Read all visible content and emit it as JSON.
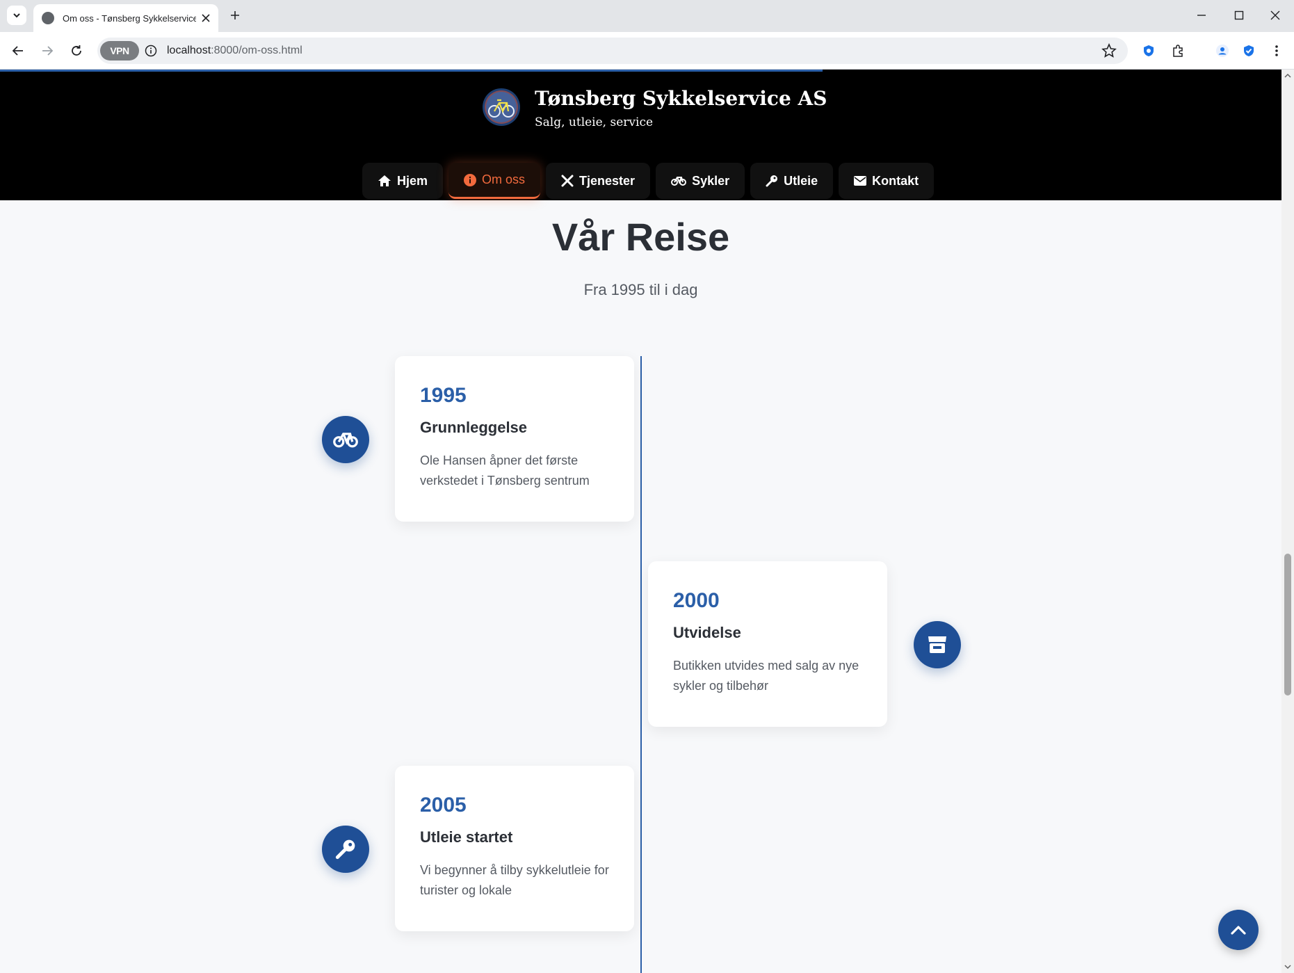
{
  "browser": {
    "tab_title": "Om oss - Tønsberg Sykkelservice AS",
    "url_host": "localhost",
    "url_path": ":8000/om-oss.html",
    "vpn_label": "VPN"
  },
  "header": {
    "brand_name": "Tønsberg Sykkelservice AS",
    "tagline": "Salg, utleie, service"
  },
  "nav": [
    {
      "label": "Hjem",
      "icon": "home-icon"
    },
    {
      "label": "Om oss",
      "icon": "info-icon",
      "active": true
    },
    {
      "label": "Tjenester",
      "icon": "tools-icon"
    },
    {
      "label": "Sykler",
      "icon": "bicycle-icon"
    },
    {
      "label": "Utleie",
      "icon": "key-icon"
    },
    {
      "label": "Kontakt",
      "icon": "envelope-icon"
    }
  ],
  "section": {
    "title": "Vår Reise",
    "subtitle": "Fra 1995 til i dag"
  },
  "timeline": [
    {
      "year": "1995",
      "title": "Grunnleggelse",
      "text": "Ole Hansen åpner det første verkstedet i Tønsberg sentrum",
      "icon": "bicycle-icon",
      "side": "left"
    },
    {
      "year": "2000",
      "title": "Utvidelse",
      "text": "Butikken utvides med salg av nye sykler og tilbehør",
      "icon": "store-icon",
      "side": "right"
    },
    {
      "year": "2005",
      "title": "Utleie startet",
      "text": "Vi begynner å tilby sykkelutleie for turister og lokale",
      "icon": "key-icon",
      "side": "left"
    }
  ],
  "colors": {
    "primary": "#2b5fa8",
    "marker": "#1f4f96",
    "accent": "#f26a3d",
    "header_bg": "#000000"
  }
}
